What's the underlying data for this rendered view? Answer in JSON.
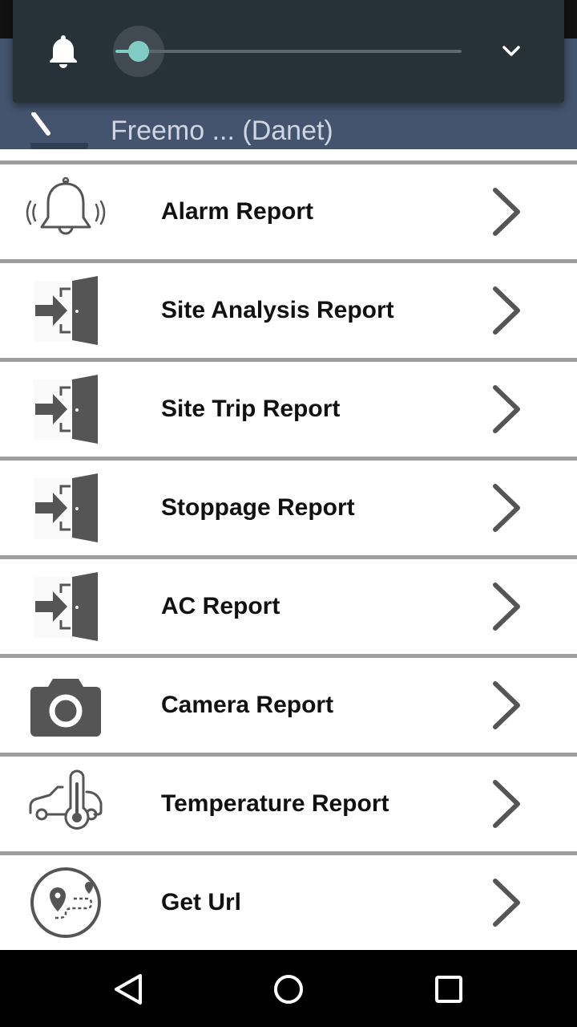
{
  "appbar": {
    "title": "Freemo ... (Danet)"
  },
  "volume": {
    "level": 0.07,
    "accent": "#80cbc4",
    "icon": "bell-icon",
    "expand_icon": "chevron-down-icon"
  },
  "list": {
    "items": [
      {
        "label": "Alarm Report",
        "icon": "bell-ringing-icon"
      },
      {
        "label": "Site Analysis Report",
        "icon": "door-enter-icon"
      },
      {
        "label": "Site Trip Report",
        "icon": "door-enter-icon"
      },
      {
        "label": "Stoppage Report",
        "icon": "door-enter-icon"
      },
      {
        "label": "AC Report",
        "icon": "door-enter-icon"
      },
      {
        "label": "Camera Report",
        "icon": "camera-icon"
      },
      {
        "label": "Temperature Report",
        "icon": "car-thermometer-icon"
      },
      {
        "label": "Get Url",
        "icon": "map-route-icon"
      }
    ],
    "chevron_icon": "chevron-right-icon"
  },
  "navbar": {
    "back": "nav-back-icon",
    "home": "nav-home-icon",
    "recents": "nav-recents-icon"
  },
  "colors": {
    "appbar": "#44546e",
    "divider": "#9e9e9e",
    "icon": "#555555"
  }
}
